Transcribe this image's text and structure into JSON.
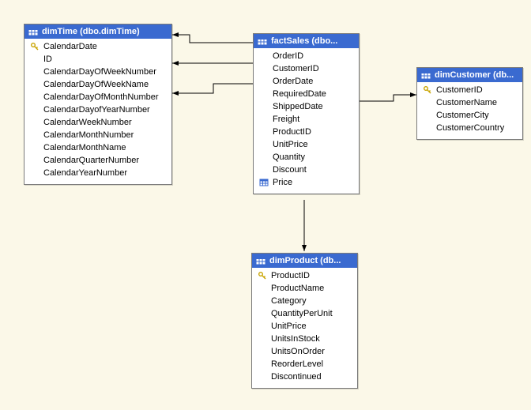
{
  "tables": {
    "dimTime": {
      "title": "dimTime (dbo.dimTime)",
      "columns": [
        {
          "name": "CalendarDate",
          "icon": "key"
        },
        {
          "name": "ID",
          "icon": "none"
        },
        {
          "name": "CalendarDayOfWeekNumber",
          "icon": "none"
        },
        {
          "name": "CalendarDayOfWeekName",
          "icon": "none"
        },
        {
          "name": "CalendarDayOfMonthNumber",
          "icon": "none"
        },
        {
          "name": "CalendarDayofYearNumber",
          "icon": "none"
        },
        {
          "name": "CalendarWeekNumber",
          "icon": "none"
        },
        {
          "name": "CalendarMonthNumber",
          "icon": "none"
        },
        {
          "name": "CalendarMonthName",
          "icon": "none"
        },
        {
          "name": "CalendarQuarterNumber",
          "icon": "none"
        },
        {
          "name": "CalendarYearNumber",
          "icon": "none"
        }
      ]
    },
    "factSales": {
      "title": "factSales (dbo...",
      "columns": [
        {
          "name": "OrderID",
          "icon": "none"
        },
        {
          "name": "CustomerID",
          "icon": "none"
        },
        {
          "name": "OrderDate",
          "icon": "none"
        },
        {
          "name": "RequiredDate",
          "icon": "none"
        },
        {
          "name": "ShippedDate",
          "icon": "none"
        },
        {
          "name": "Freight",
          "icon": "none"
        },
        {
          "name": "ProductID",
          "icon": "none"
        },
        {
          "name": "UnitPrice",
          "icon": "none"
        },
        {
          "name": "Quantity",
          "icon": "none"
        },
        {
          "name": "Discount",
          "icon": "none"
        },
        {
          "name": "Price",
          "icon": "table"
        }
      ]
    },
    "dimCustomer": {
      "title": "dimCustomer (db...",
      "columns": [
        {
          "name": "CustomerID",
          "icon": "key"
        },
        {
          "name": "CustomerName",
          "icon": "none"
        },
        {
          "name": "CustomerCity",
          "icon": "none"
        },
        {
          "name": "CustomerCountry",
          "icon": "none"
        }
      ]
    },
    "dimProduct": {
      "title": "dimProduct (db...",
      "columns": [
        {
          "name": "ProductID",
          "icon": "key"
        },
        {
          "name": "ProductName",
          "icon": "none"
        },
        {
          "name": "Category",
          "icon": "none"
        },
        {
          "name": "QuantityPerUnit",
          "icon": "none"
        },
        {
          "name": "UnitPrice",
          "icon": "none"
        },
        {
          "name": "UnitsInStock",
          "icon": "none"
        },
        {
          "name": "UnitsOnOrder",
          "icon": "none"
        },
        {
          "name": "ReorderLevel",
          "icon": "none"
        },
        {
          "name": "Discontinued",
          "icon": "none"
        }
      ]
    }
  }
}
